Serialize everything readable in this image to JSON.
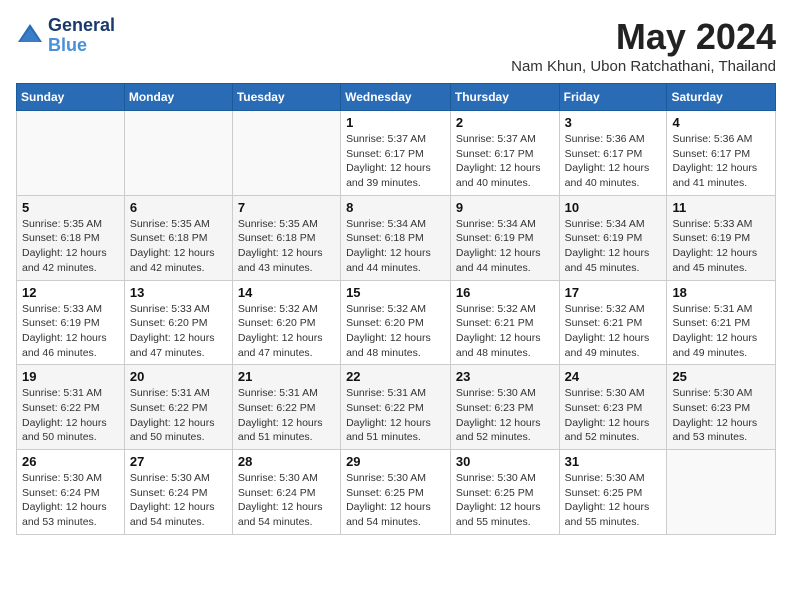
{
  "header": {
    "logo_line1": "General",
    "logo_line2": "Blue",
    "month_year": "May 2024",
    "location": "Nam Khun, Ubon Ratchathani, Thailand"
  },
  "weekdays": [
    "Sunday",
    "Monday",
    "Tuesday",
    "Wednesday",
    "Thursday",
    "Friday",
    "Saturday"
  ],
  "weeks": [
    [
      {
        "day": "",
        "info": ""
      },
      {
        "day": "",
        "info": ""
      },
      {
        "day": "",
        "info": ""
      },
      {
        "day": "1",
        "info": "Sunrise: 5:37 AM\nSunset: 6:17 PM\nDaylight: 12 hours\nand 39 minutes."
      },
      {
        "day": "2",
        "info": "Sunrise: 5:37 AM\nSunset: 6:17 PM\nDaylight: 12 hours\nand 40 minutes."
      },
      {
        "day": "3",
        "info": "Sunrise: 5:36 AM\nSunset: 6:17 PM\nDaylight: 12 hours\nand 40 minutes."
      },
      {
        "day": "4",
        "info": "Sunrise: 5:36 AM\nSunset: 6:17 PM\nDaylight: 12 hours\nand 41 minutes."
      }
    ],
    [
      {
        "day": "5",
        "info": "Sunrise: 5:35 AM\nSunset: 6:18 PM\nDaylight: 12 hours\nand 42 minutes."
      },
      {
        "day": "6",
        "info": "Sunrise: 5:35 AM\nSunset: 6:18 PM\nDaylight: 12 hours\nand 42 minutes."
      },
      {
        "day": "7",
        "info": "Sunrise: 5:35 AM\nSunset: 6:18 PM\nDaylight: 12 hours\nand 43 minutes."
      },
      {
        "day": "8",
        "info": "Sunrise: 5:34 AM\nSunset: 6:18 PM\nDaylight: 12 hours\nand 44 minutes."
      },
      {
        "day": "9",
        "info": "Sunrise: 5:34 AM\nSunset: 6:19 PM\nDaylight: 12 hours\nand 44 minutes."
      },
      {
        "day": "10",
        "info": "Sunrise: 5:34 AM\nSunset: 6:19 PM\nDaylight: 12 hours\nand 45 minutes."
      },
      {
        "day": "11",
        "info": "Sunrise: 5:33 AM\nSunset: 6:19 PM\nDaylight: 12 hours\nand 45 minutes."
      }
    ],
    [
      {
        "day": "12",
        "info": "Sunrise: 5:33 AM\nSunset: 6:19 PM\nDaylight: 12 hours\nand 46 minutes."
      },
      {
        "day": "13",
        "info": "Sunrise: 5:33 AM\nSunset: 6:20 PM\nDaylight: 12 hours\nand 47 minutes."
      },
      {
        "day": "14",
        "info": "Sunrise: 5:32 AM\nSunset: 6:20 PM\nDaylight: 12 hours\nand 47 minutes."
      },
      {
        "day": "15",
        "info": "Sunrise: 5:32 AM\nSunset: 6:20 PM\nDaylight: 12 hours\nand 48 minutes."
      },
      {
        "day": "16",
        "info": "Sunrise: 5:32 AM\nSunset: 6:21 PM\nDaylight: 12 hours\nand 48 minutes."
      },
      {
        "day": "17",
        "info": "Sunrise: 5:32 AM\nSunset: 6:21 PM\nDaylight: 12 hours\nand 49 minutes."
      },
      {
        "day": "18",
        "info": "Sunrise: 5:31 AM\nSunset: 6:21 PM\nDaylight: 12 hours\nand 49 minutes."
      }
    ],
    [
      {
        "day": "19",
        "info": "Sunrise: 5:31 AM\nSunset: 6:22 PM\nDaylight: 12 hours\nand 50 minutes."
      },
      {
        "day": "20",
        "info": "Sunrise: 5:31 AM\nSunset: 6:22 PM\nDaylight: 12 hours\nand 50 minutes."
      },
      {
        "day": "21",
        "info": "Sunrise: 5:31 AM\nSunset: 6:22 PM\nDaylight: 12 hours\nand 51 minutes."
      },
      {
        "day": "22",
        "info": "Sunrise: 5:31 AM\nSunset: 6:22 PM\nDaylight: 12 hours\nand 51 minutes."
      },
      {
        "day": "23",
        "info": "Sunrise: 5:30 AM\nSunset: 6:23 PM\nDaylight: 12 hours\nand 52 minutes."
      },
      {
        "day": "24",
        "info": "Sunrise: 5:30 AM\nSunset: 6:23 PM\nDaylight: 12 hours\nand 52 minutes."
      },
      {
        "day": "25",
        "info": "Sunrise: 5:30 AM\nSunset: 6:23 PM\nDaylight: 12 hours\nand 53 minutes."
      }
    ],
    [
      {
        "day": "26",
        "info": "Sunrise: 5:30 AM\nSunset: 6:24 PM\nDaylight: 12 hours\nand 53 minutes."
      },
      {
        "day": "27",
        "info": "Sunrise: 5:30 AM\nSunset: 6:24 PM\nDaylight: 12 hours\nand 54 minutes."
      },
      {
        "day": "28",
        "info": "Sunrise: 5:30 AM\nSunset: 6:24 PM\nDaylight: 12 hours\nand 54 minutes."
      },
      {
        "day": "29",
        "info": "Sunrise: 5:30 AM\nSunset: 6:25 PM\nDaylight: 12 hours\nand 54 minutes."
      },
      {
        "day": "30",
        "info": "Sunrise: 5:30 AM\nSunset: 6:25 PM\nDaylight: 12 hours\nand 55 minutes."
      },
      {
        "day": "31",
        "info": "Sunrise: 5:30 AM\nSunset: 6:25 PM\nDaylight: 12 hours\nand 55 minutes."
      },
      {
        "day": "",
        "info": ""
      }
    ]
  ]
}
